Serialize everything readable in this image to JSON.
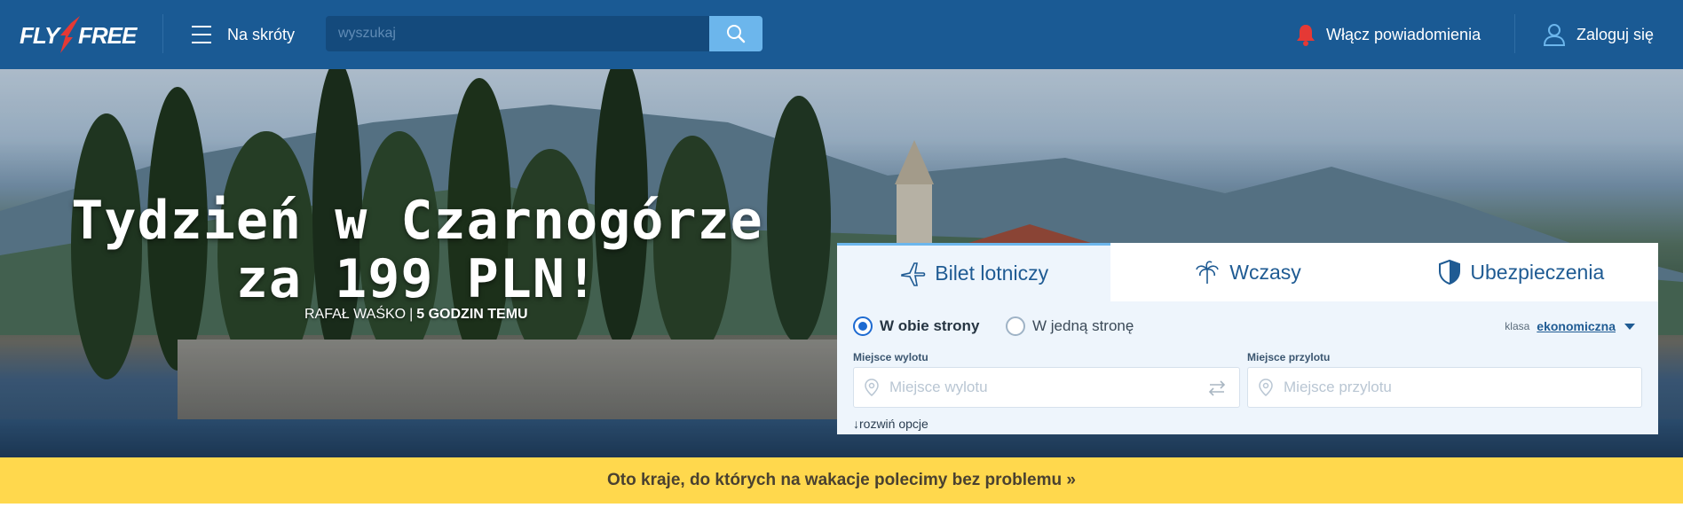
{
  "header": {
    "logo_left": "FLY",
    "logo_right": "FREE",
    "menu_label": "Na skróty",
    "search_placeholder": "wyszukaj",
    "notifications_label": "Włącz powiadomienia",
    "login_label": "Zaloguj się",
    "colors": {
      "bar": "#1a5a94",
      "search_button": "#6cb6ec",
      "bell": "#e53935"
    }
  },
  "hero": {
    "title": "Tydzień w Czarnogórze za 199 PLN!",
    "author": "Rafał Waśko",
    "separator": "|",
    "time_ago": "5 GODZIN TEMU"
  },
  "booking": {
    "tabs": [
      {
        "label": "Bilet lotniczy",
        "icon": "plane-icon",
        "active": true
      },
      {
        "label": "Wczasy",
        "icon": "palm-tree-icon",
        "active": false
      },
      {
        "label": "Ubezpieczenia",
        "icon": "shield-icon",
        "active": false
      }
    ],
    "trip_types": [
      {
        "label": "W obie strony",
        "selected": true
      },
      {
        "label": "W jedną stronę",
        "selected": false
      }
    ],
    "class_label": "klasa",
    "class_value": "ekonomiczna",
    "from": {
      "label": "Miejsce wylotu",
      "placeholder": "Miejsce wylotu"
    },
    "to": {
      "label": "Miejsce przylotu",
      "placeholder": "Miejsce przylotu"
    },
    "expand_label": "↓rozwiń opcje"
  },
  "banner": {
    "text": "Oto kraje, do których na wakacje polecimy bez problemu »",
    "color": "#ffd84d"
  }
}
